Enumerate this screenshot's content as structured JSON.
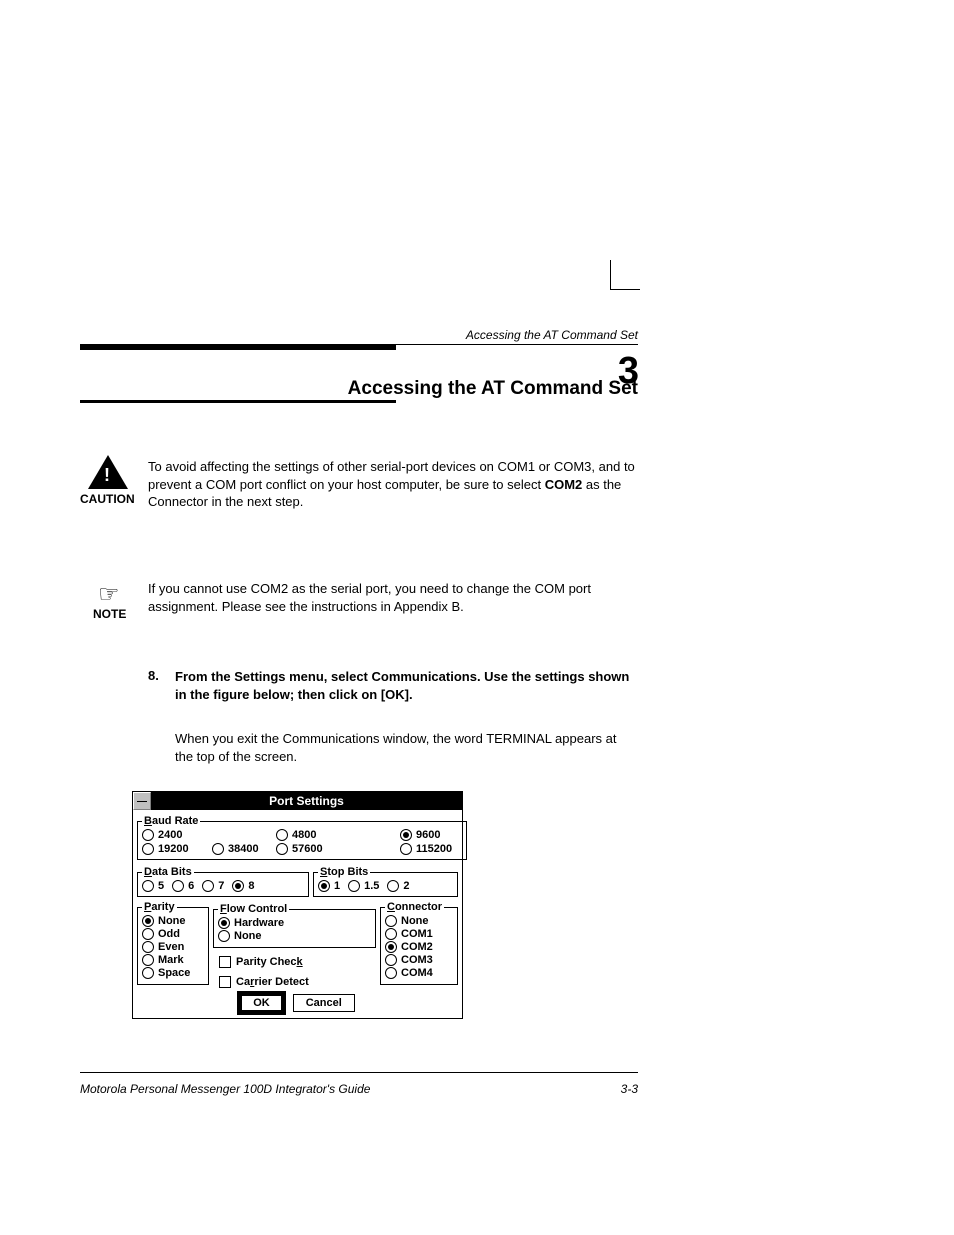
{
  "runningHead": "Accessing the AT Command Set",
  "chapter": {
    "number": "3",
    "title": "Accessing the AT Command Set"
  },
  "caution": {
    "label": "CAUTION",
    "text_lead": "To avoid affecting the settings of other serial-port devices on COM1 or COM3, and to prevent a COM port conflict on your host computer, be sure to select ",
    "text_bold": "COM2",
    "text_tail": " as the Connector in the next step."
  },
  "note": {
    "label": "NOTE",
    "text": "If you cannot use COM2 as the serial port, you need to change the COM port assignment. Please see the instructions in Appendix B."
  },
  "step": {
    "num": "8.",
    "line1": "From the Settings menu, select Communications. Use the settings shown in the figure below; then click on [OK].",
    "line2": "When you exit the Communications window, the word TERMINAL appears at the top of the screen."
  },
  "dialog": {
    "title": "Port Settings",
    "sysmenu_glyph": "—",
    "baud": {
      "legend_u": "B",
      "legend_rest": "aud Rate",
      "options": [
        "2400",
        "4800",
        "9600",
        "19200",
        "38400",
        "57600",
        "115200"
      ],
      "selected": "9600"
    },
    "databits": {
      "legend_u": "D",
      "legend_rest": "ata Bits",
      "options": [
        "5",
        "6",
        "7",
        "8"
      ],
      "selected": "8"
    },
    "stopbits": {
      "legend_u": "S",
      "legend_rest": "top Bits",
      "options": [
        "1",
        "1.5",
        "2"
      ],
      "selected": "1"
    },
    "parity": {
      "legend_u": "P",
      "legend_rest": "arity",
      "options": [
        "None",
        "Odd",
        "Even",
        "Mark",
        "Space"
      ],
      "selected": "None"
    },
    "flow": {
      "legend_u": "F",
      "legend_rest": "low Control",
      "options": [
        "Hardware",
        "None"
      ],
      "selected": "Hardware",
      "parity_check_u": "k",
      "parity_check_pre": "Parity Chec",
      "carrier_detect_u": "r",
      "carrier_detect_pre": "Ca",
      "carrier_detect_post": "rier Detect"
    },
    "connector": {
      "legend_u": "C",
      "legend_rest": "onnector",
      "options": [
        "None",
        "COM1",
        "COM2",
        "COM3",
        "COM4"
      ],
      "selected": "COM2"
    },
    "buttons": {
      "ok": "OK",
      "cancel": "Cancel"
    }
  },
  "footer": {
    "text": "Motorola Personal Messenger 100D Integrator's Guide",
    "page": "3-3"
  }
}
